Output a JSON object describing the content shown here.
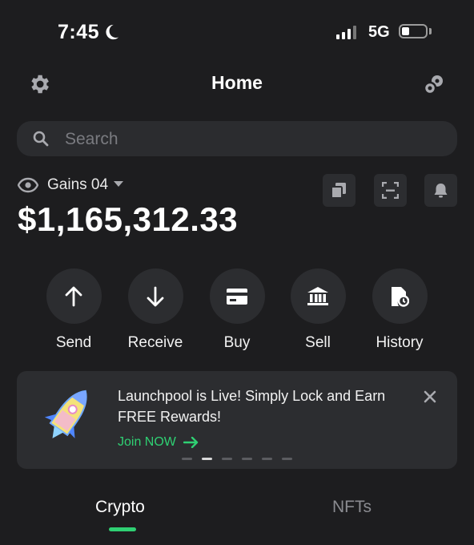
{
  "status_bar": {
    "time": "7:45",
    "network": "5G"
  },
  "header": {
    "title": "Home"
  },
  "search": {
    "placeholder": "Search"
  },
  "wallet": {
    "name": "Gains 04",
    "balance": "$1,165,312.33"
  },
  "actions": [
    {
      "label": "Send",
      "icon": "arrow-up-icon"
    },
    {
      "label": "Receive",
      "icon": "arrow-down-icon"
    },
    {
      "label": "Buy",
      "icon": "card-icon"
    },
    {
      "label": "Sell",
      "icon": "bank-icon"
    },
    {
      "label": "History",
      "icon": "history-icon"
    }
  ],
  "banner": {
    "text": "Launchpool is Live! Simply Lock and Earn FREE Rewards!",
    "cta": "Join NOW",
    "cta_color": "#2fd073",
    "slide_count": 6,
    "active_slide": 2
  },
  "tabs": [
    {
      "label": "Crypto",
      "active": true
    },
    {
      "label": "NFTs",
      "active": false
    }
  ],
  "colors": {
    "background": "#1d1d1f",
    "surface": "#2c2d30",
    "accent": "#2fd073"
  }
}
